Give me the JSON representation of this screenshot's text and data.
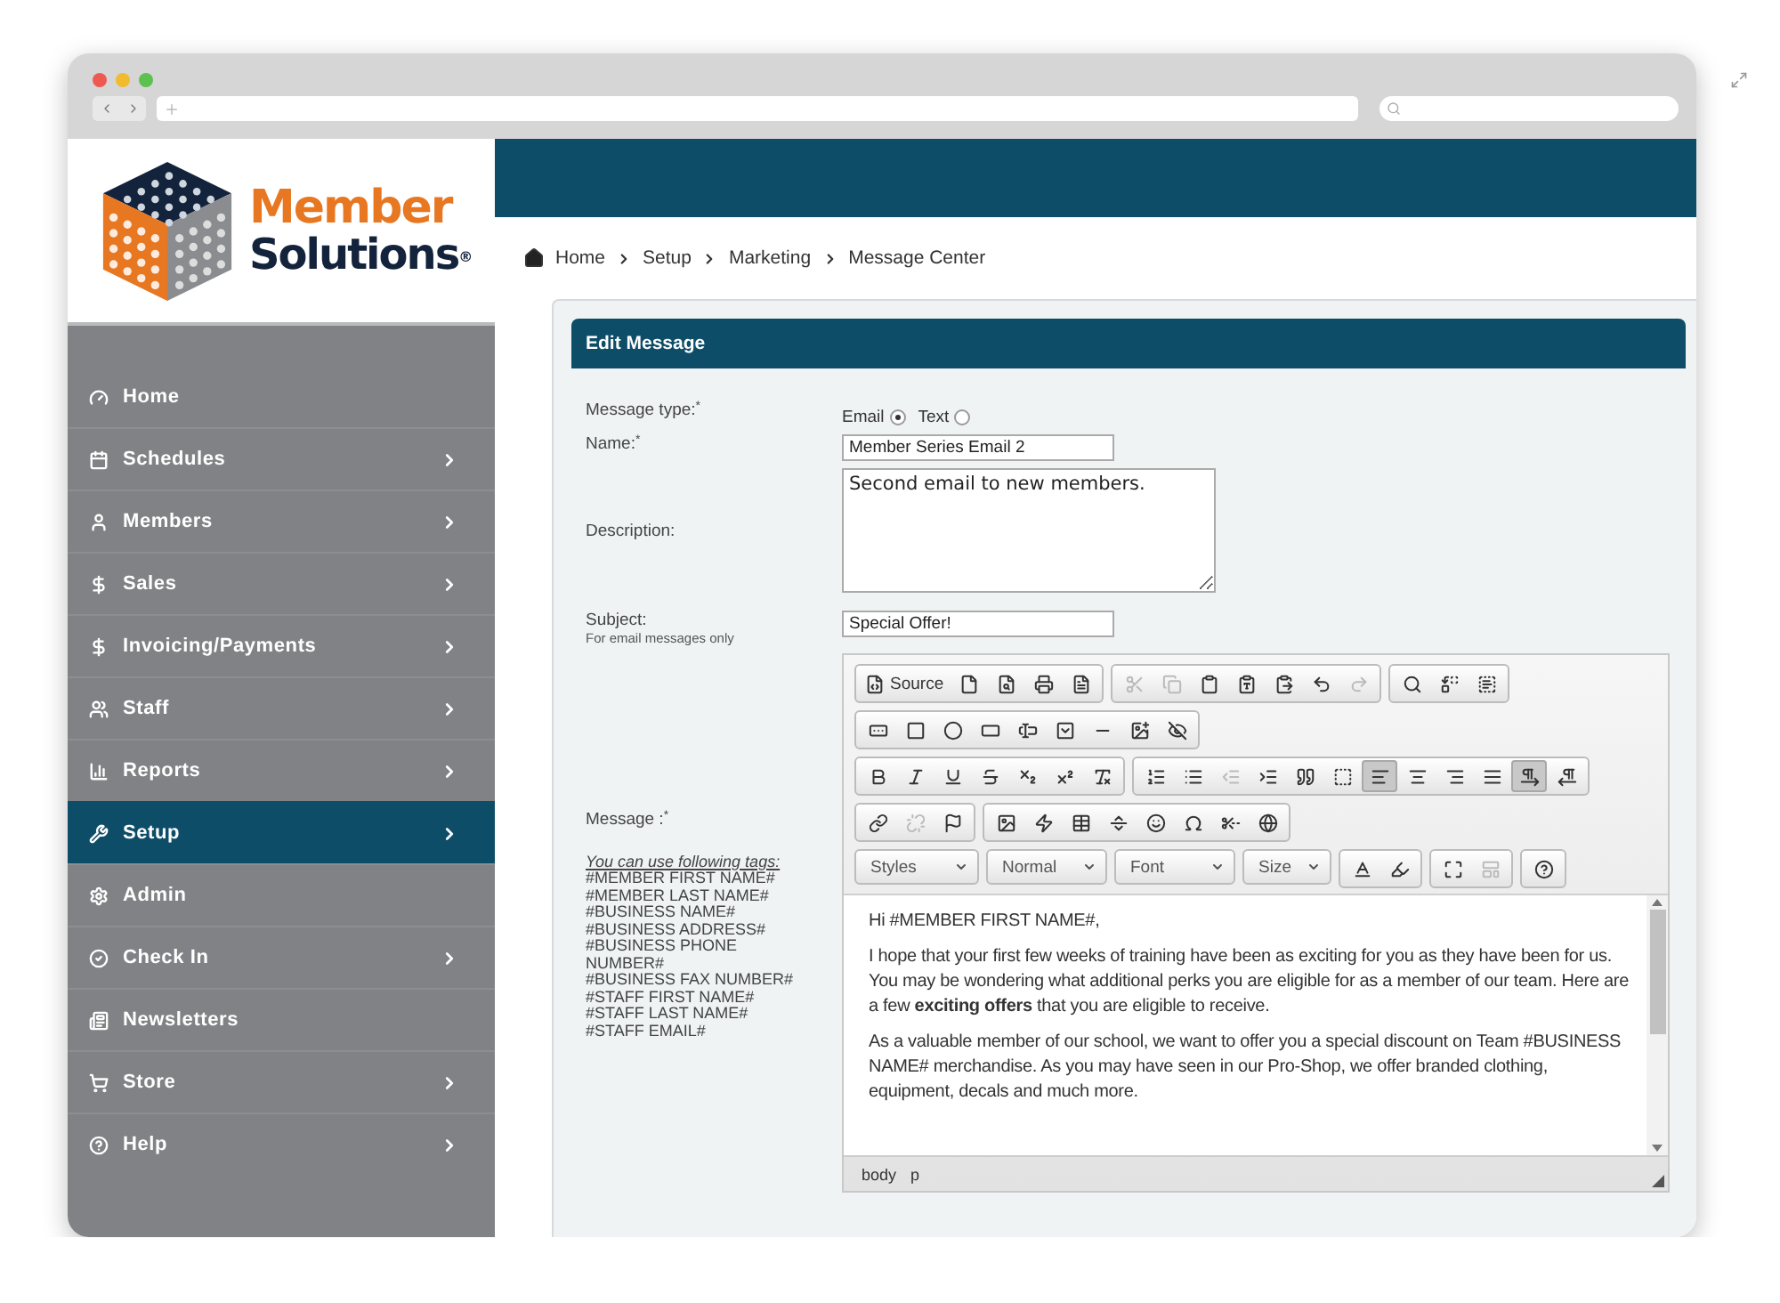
{
  "logo": {
    "line1": "Member",
    "line2": "Solutions",
    "mark": "®"
  },
  "sidebar": {
    "items": [
      {
        "label": "Home",
        "submenu": false,
        "selected": false
      },
      {
        "label": "Schedules",
        "submenu": true,
        "selected": false
      },
      {
        "label": "Members",
        "submenu": true,
        "selected": false
      },
      {
        "label": "Sales",
        "submenu": true,
        "selected": false
      },
      {
        "label": "Invoicing/Payments",
        "submenu": true,
        "selected": false
      },
      {
        "label": "Staff",
        "submenu": true,
        "selected": false
      },
      {
        "label": "Reports",
        "submenu": true,
        "selected": false
      },
      {
        "label": "Setup",
        "submenu": true,
        "selected": true
      },
      {
        "label": "Admin",
        "submenu": false,
        "selected": false
      },
      {
        "label": "Check In",
        "submenu": true,
        "selected": false
      },
      {
        "label": "Newsletters",
        "submenu": false,
        "selected": false
      },
      {
        "label": "Store",
        "submenu": true,
        "selected": false
      },
      {
        "label": "Help",
        "submenu": true,
        "selected": false
      }
    ]
  },
  "breadcrumb": [
    "Home",
    "Setup",
    "Marketing",
    "Message Center"
  ],
  "panel": {
    "title": "Edit Message",
    "message_type": {
      "label": "Message type:$^{*}$",
      "options": [
        {
          "label": "Email",
          "selected": true
        },
        {
          "label": "Text",
          "selected": false
        }
      ]
    },
    "name": {
      "label": "Name:$^{*}$",
      "value": "Member Series Email 2"
    },
    "description": {
      "label": "Description:",
      "value": "Second email to new members."
    },
    "subject": {
      "label": "Subject:",
      "hint": "For email messages only",
      "value": "Special Offer!"
    },
    "message": {
      "label": "Message :$^{*}$",
      "tags_title": "You can use following tags:",
      "tags": [
        "#MEMBER FIRST NAME#",
        "#MEMBER LAST NAME#",
        "#BUSINESS NAME#",
        "#BUSINESS ADDRESS#",
        "#BUSINESS PHONE NUMBER#",
        "#BUSINESS FAX NUMBER#",
        "#STAFF FIRST NAME#",
        "#STAFF LAST NAME#",
        "#STAFF EMAIL#"
      ]
    }
  },
  "editor": {
    "toolbar": [
      [
        [
          {
            "label": "Source",
            "disabled": false,
            "selected": false
          },
          {
            "disabled": false,
            "selected": false
          },
          {
            "disabled": false,
            "selected": false
          },
          {
            "disabled": false,
            "selected": false
          },
          {
            "disabled": false,
            "selected": false
          }
        ],
        [
          {
            "disabled": true,
            "selected": false
          },
          {
            "disabled": true,
            "selected": false
          },
          {
            "disabled": false,
            "selected": false
          },
          {
            "disabled": false,
            "selected": false
          },
          {
            "disabled": false,
            "selected": false
          },
          {
            "disabled": false,
            "selected": false
          },
          {
            "disabled": true,
            "selected": false
          }
        ],
        [
          {
            "disabled": false,
            "selected": false
          },
          {
            "disabled": false,
            "selected": false
          },
          {
            "disabled": false,
            "selected": false
          }
        ]
      ],
      [
        [
          {
            "disabled": false,
            "selected": false
          },
          {
            "disabled": false,
            "selected": false
          },
          {
            "disabled": false,
            "selected": false
          },
          {
            "disabled": false,
            "selected": false
          },
          {
            "disabled": false,
            "selected": false
          },
          {
            "disabled": false,
            "selected": false
          },
          {
            "disabled": false,
            "selected": false
          },
          {
            "disabled": false,
            "selected": false
          },
          {
            "disabled": false,
            "selected": false
          }
        ]
      ],
      [
        [
          {
            "disabled": false,
            "selected": false
          },
          {
            "disabled": false,
            "selected": false
          },
          {
            "disabled": false,
            "selected": false
          },
          {
            "disabled": false,
            "selected": false
          },
          {
            "disabled": false,
            "selected": false
          },
          {
            "disabled": false,
            "selected": false
          },
          {
            "disabled": false,
            "selected": false
          }
        ],
        [
          {
            "disabled": false,
            "selected": false
          },
          {
            "disabled": false,
            "selected": false
          },
          {
            "disabled": true,
            "selected": false
          },
          {
            "disabled": false,
            "selected": false
          },
          {
            "disabled": false,
            "selected": false
          },
          {
            "disabled": false,
            "selected": false
          },
          {
            "disabled": false,
            "selected": true
          },
          {
            "disabled": false,
            "selected": false
          },
          {
            "disabled": false,
            "selected": false
          },
          {
            "disabled": false,
            "selected": false
          },
          {
            "disabled": false,
            "selected": true
          },
          {
            "disabled": false,
            "selected": false
          }
        ]
      ],
      [
        [
          {
            "disabled": false,
            "selected": false
          },
          {
            "disabled": true,
            "selected": false
          },
          {
            "disabled": false,
            "selected": false
          }
        ],
        [
          {
            "disabled": false,
            "selected": false
          },
          {
            "disabled": false,
            "selected": false
          },
          {
            "disabled": false,
            "selected": false
          },
          {
            "disabled": false,
            "selected": false
          },
          {
            "disabled": false,
            "selected": false
          },
          {
            "disabled": false,
            "selected": false
          },
          {
            "disabled": false,
            "selected": false
          },
          {
            "disabled": false,
            "selected": false
          }
        ]
      ]
    ],
    "combos": [
      "Styles",
      "Normal",
      "Font",
      "Size"
    ],
    "last_row": [
      [
        {
          "disabled": false,
          "selected": false
        },
        {
          "disabled": false,
          "selected": false
        }
      ],
      [
        {
          "disabled": false,
          "selected": false
        },
        {
          "disabled": true,
          "selected": false
        }
      ],
      [
        {
          "disabled": false,
          "selected": false
        }
      ]
    ],
    "paragraphs": [
      "Hi #MEMBER FIRST NAME#,",
      "I hope that your first few weeks of training have been as exciting for you as they have been for us.  You may be wondering what additional perks you are eligible for as a member of our team.  Here are a few **exciting offers** that you are eligible to receive.",
      "As a valuable member of our school, we want to offer you a special discount on Team #BUSINESS NAME# merchandise.  As you may have seen in our Pro-Shop, we offer branded clothing, equipment, decals and much more."
    ],
    "path": [
      "body",
      "p"
    ]
  }
}
